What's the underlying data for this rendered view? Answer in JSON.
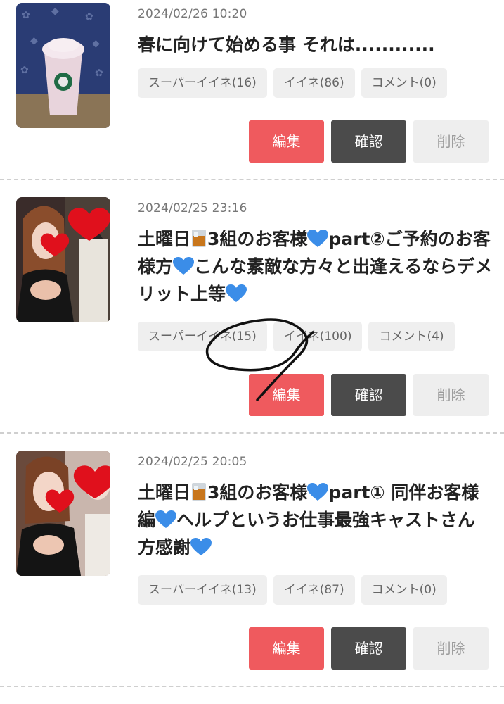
{
  "posts": [
    {
      "date": "2024/02/26 10:20",
      "title_parts": [
        "春に向けて始める事 それは............"
      ],
      "thumb_icon": "frappuccino-photo",
      "stats": {
        "super_like": "スーパーイイネ(16)",
        "like": "イイネ(86)",
        "comment": "コメント(0)"
      },
      "buttons": {
        "edit": "編集",
        "confirm": "確認",
        "delete": "削除"
      }
    },
    {
      "date": "2024/02/25 23:16",
      "title_parts": [
        "土曜日",
        "3組のお客様",
        "part②ご予約のお客様方",
        "こんな素敵な方々と出逢えるならデメリット上等"
      ],
      "thumb_icon": "selfie-photo-with-heart-stickers",
      "stats": {
        "super_like": "スーパーイイネ(15)",
        "like": "イイネ(100)",
        "comment": "コメント(4)"
      },
      "buttons": {
        "edit": "編集",
        "confirm": "確認",
        "delete": "削除"
      }
    },
    {
      "date": "2024/02/25 20:05",
      "title_parts": [
        "土曜日",
        "3組のお客様",
        "part① 同伴お客様編",
        "ヘルプというお仕事最強キャストさん方感謝"
      ],
      "thumb_icon": "selfie-photo-with-heart-stickers",
      "stats": {
        "super_like": "スーパーイイネ(13)",
        "like": "イイネ(87)",
        "comment": "コメント(0)"
      },
      "buttons": {
        "edit": "編集",
        "confirm": "確認",
        "delete": "削除"
      }
    }
  ],
  "colors": {
    "edit": "#ef5a5e",
    "confirm": "#4b4b4b",
    "delete_bg": "#eeeeee",
    "heart_blue": "#3b8de8",
    "heart_red": "#e0101c",
    "pill_bg": "#efefef"
  }
}
